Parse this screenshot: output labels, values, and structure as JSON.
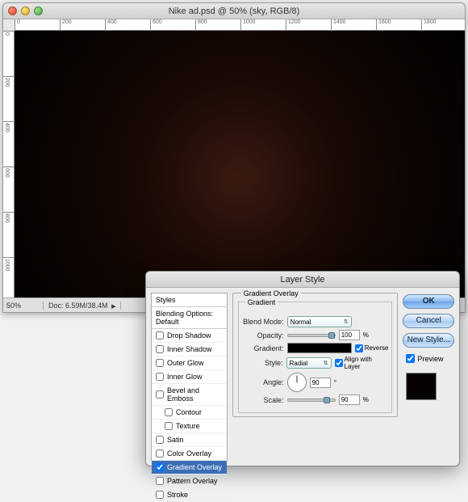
{
  "window": {
    "title": "Nike ad.psd @ 50% (sky, RGB/8)",
    "zoom": "50%",
    "doc_info": "Doc: 6.59M/38.4M",
    "ruler_marks": [
      "0",
      "200",
      "400",
      "600",
      "800",
      "1000",
      "1200",
      "1400",
      "1600",
      "1800"
    ],
    "ruler_v_marks": [
      "0",
      "200",
      "400",
      "600",
      "800",
      "1000"
    ]
  },
  "dialog": {
    "title": "Layer Style",
    "styles_header": "Styles",
    "blending_defaults": "Blending Options: Default",
    "items": {
      "drop_shadow": "Drop Shadow",
      "inner_shadow": "Inner Shadow",
      "outer_glow": "Outer Glow",
      "inner_glow": "Inner Glow",
      "bevel_emboss": "Bevel and Emboss",
      "contour": "Contour",
      "texture": "Texture",
      "satin": "Satin",
      "color_overlay": "Color Overlay",
      "gradient_overlay": "Gradient Overlay",
      "pattern_overlay": "Pattern Overlay",
      "stroke": "Stroke"
    },
    "section": "Gradient Overlay",
    "subsection": "Gradient",
    "labels": {
      "blend_mode": "Blend Mode:",
      "opacity": "Opacity:",
      "gradient": "Gradient:",
      "style": "Style:",
      "angle": "Angle:",
      "scale": "Scale:",
      "reverse": "Reverse",
      "align": "Align with Layer"
    },
    "values": {
      "blend_mode": "Normal",
      "opacity": "100",
      "style": "Radial",
      "angle": "90",
      "scale": "90",
      "degree": "°",
      "pct": "%"
    },
    "buttons": {
      "ok": "OK",
      "cancel": "Cancel",
      "new_style": "New Style...",
      "preview": "Preview"
    }
  }
}
